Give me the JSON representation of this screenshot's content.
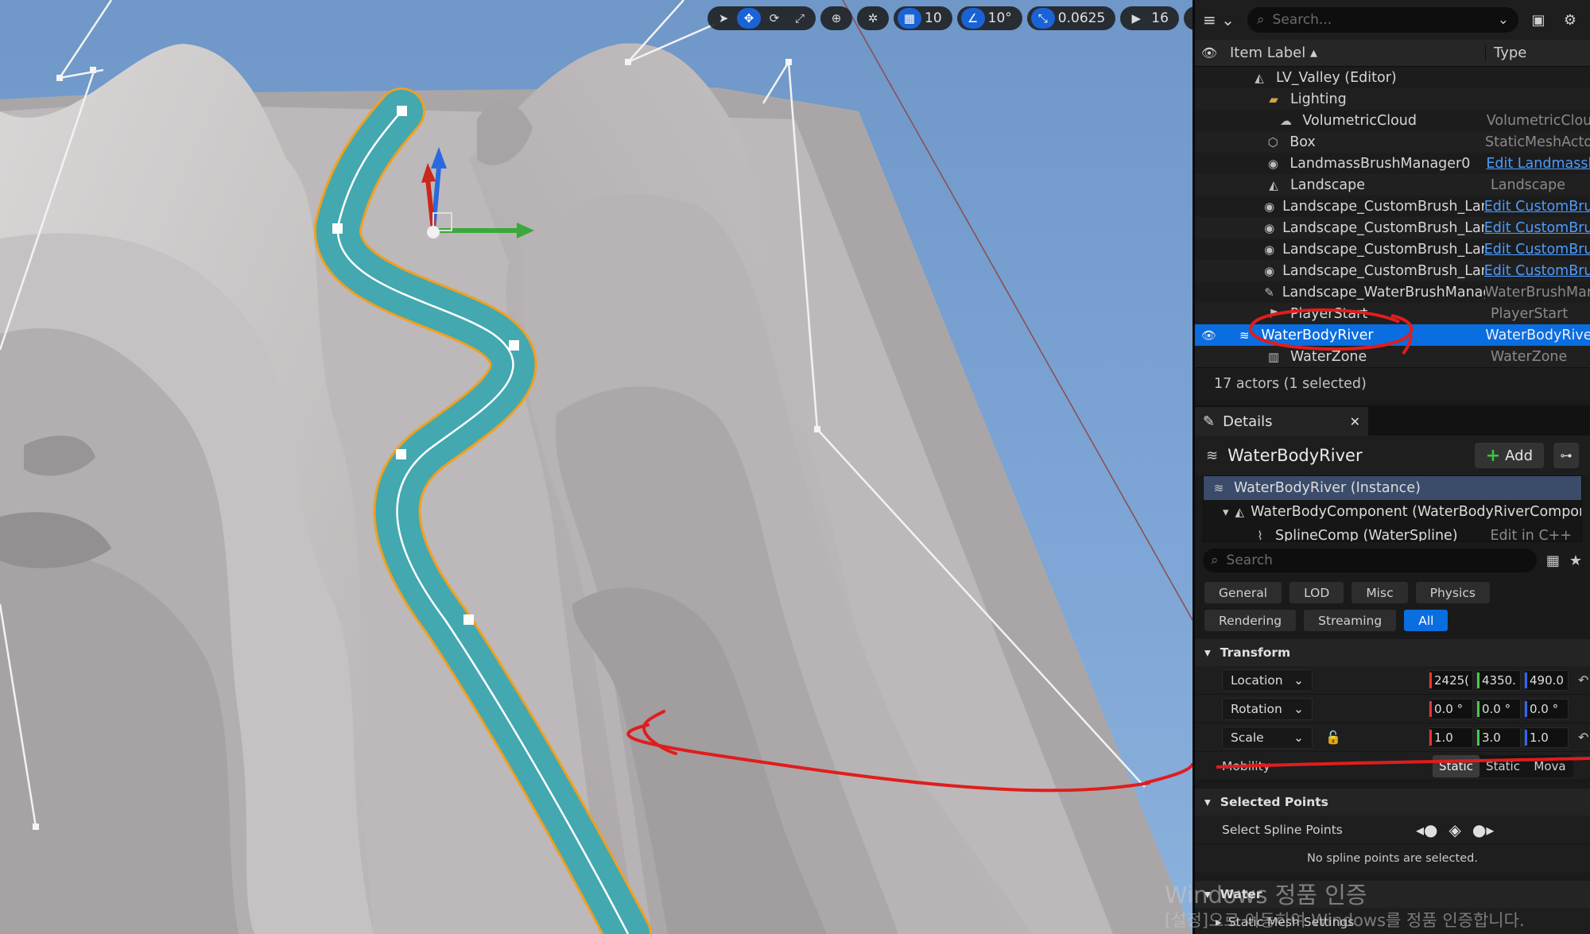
{
  "toolbar": {
    "grid_snap": "10",
    "rotation_snap": "10°",
    "scale_snap": "0.0625",
    "camera_speed": "16"
  },
  "outliner": {
    "search_placeholder": "Search...",
    "col_label": "Item Label",
    "col_type": "Type",
    "rows": [
      {
        "label": "LV_Valley (Editor)",
        "type": ""
      },
      {
        "label": "Lighting",
        "type": ""
      },
      {
        "label": "VolumetricCloud",
        "type": "VolumetricClou"
      },
      {
        "label": "Box",
        "type": "StaticMeshActo"
      },
      {
        "label": "LandmassBrushManager0",
        "type": "Edit Landmassl"
      },
      {
        "label": "Landscape",
        "type": "Landscape"
      },
      {
        "label": "Landscape_CustomBrush_Landn",
        "type": "Edit CustomBru"
      },
      {
        "label": "Landscape_CustomBrush_Landn",
        "type": "Edit CustomBru"
      },
      {
        "label": "Landscape_CustomBrush_Landn",
        "type": "Edit CustomBru"
      },
      {
        "label": "Landscape_CustomBrush_Landn",
        "type": "Edit CustomBru"
      },
      {
        "label": "Landscape_WaterBrushManager",
        "type": "WaterBrushMar"
      },
      {
        "label": "PlayerStart",
        "type": "PlayerStart"
      },
      {
        "label": "WaterBodyRiver",
        "type": "WaterBodyRive"
      },
      {
        "label": "WaterZone",
        "type": "WaterZone"
      }
    ],
    "status": "17 actors (1 selected)"
  },
  "details": {
    "tab_label": "Details",
    "title": "WaterBodyRiver",
    "add_label": "Add",
    "components": [
      {
        "label": "WaterBodyRiver (Instance)"
      },
      {
        "label": "WaterBodyComponent (WaterBodyRiverComponent)"
      },
      {
        "label": "SplineComp (WaterSpline)",
        "edit": "Edit in C++"
      }
    ],
    "search_placeholder": "Search",
    "categories": [
      "General",
      "LOD",
      "Misc",
      "Physics",
      "Rendering",
      "Streaming",
      "All"
    ],
    "active_category": "All",
    "transform_header": "Transform",
    "location_label": "Location",
    "location": [
      "2425(",
      "4350.",
      "490.0"
    ],
    "rotation_label": "Rotation",
    "rotation": [
      "0.0 °",
      "0.0 °",
      "0.0 °"
    ],
    "scale_label": "Scale",
    "scale": [
      "1.0",
      "3.0",
      "1.0"
    ],
    "mobility_label": "Mobility",
    "mobility_options": [
      "Static",
      "Static",
      "Mova"
    ],
    "selected_points_header": "Selected Points",
    "select_spline_points": "Select Spline Points",
    "no_points": "No spline points are selected.",
    "water_header": "Water",
    "static_mesh_settings": "Static Mesh Settings"
  },
  "watermark": {
    "line1": "Windows 정품 인증",
    "line2": "[설정]으로 이동하여 Windows를 정품 인증합니다."
  }
}
